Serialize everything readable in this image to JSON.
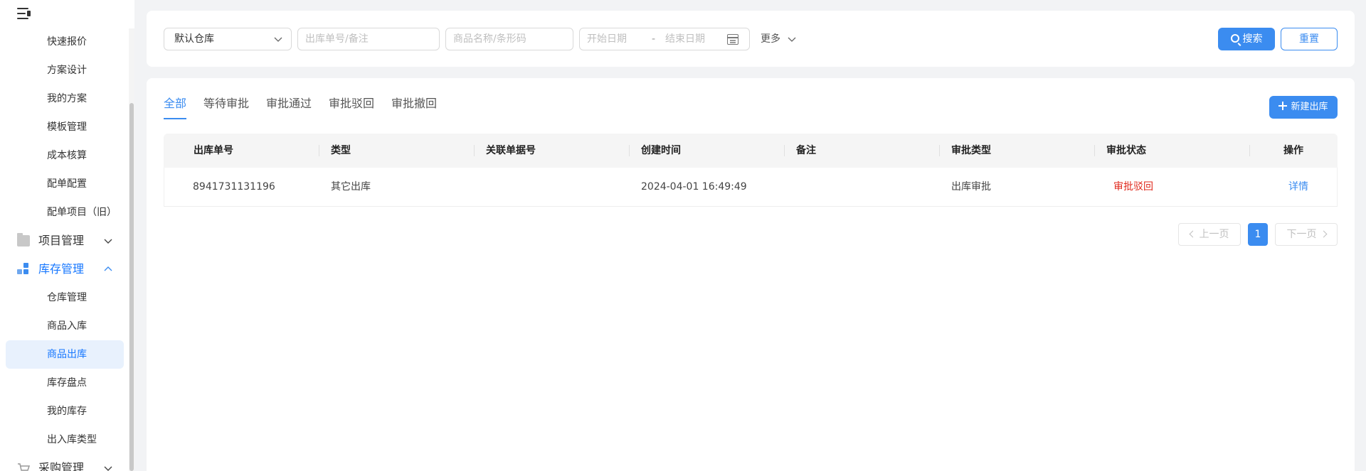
{
  "sidebar": {
    "sub_items_top": [
      {
        "label": "快速报价"
      },
      {
        "label": "方案设计"
      },
      {
        "label": "我的方案"
      },
      {
        "label": "模板管理"
      },
      {
        "label": "成本核算"
      },
      {
        "label": "配单配置"
      },
      {
        "label": "配单项目（旧）"
      }
    ],
    "group_project": {
      "label": "项目管理",
      "icon": "folder-icon"
    },
    "group_inventory": {
      "label": "库存管理",
      "icon": "inventory-icon"
    },
    "inventory_items": [
      {
        "label": "仓库管理"
      },
      {
        "label": "商品入库"
      },
      {
        "label": "商品出库",
        "active": true
      },
      {
        "label": "库存盘点"
      },
      {
        "label": "我的库存"
      },
      {
        "label": "出入库类型"
      }
    ],
    "group_purchase": {
      "label": "采购管理",
      "icon": "cart-icon"
    }
  },
  "filters": {
    "warehouse_select": {
      "value": "默认仓库"
    },
    "order_input": {
      "placeholder": "出库单号/备注",
      "value": ""
    },
    "product_input": {
      "placeholder": "商品名称/条形码",
      "value": ""
    },
    "date_range": {
      "start_placeholder": "开始日期",
      "separator": "-",
      "end_placeholder": "结束日期"
    },
    "more_label": "更多",
    "search_label": "搜索",
    "reset_label": "重置"
  },
  "tabs": [
    {
      "label": "全部",
      "active": true
    },
    {
      "label": "等待审批"
    },
    {
      "label": "审批通过"
    },
    {
      "label": "审批驳回"
    },
    {
      "label": "审批撤回"
    }
  ],
  "new_button_label": "新建出库",
  "table": {
    "columns": [
      "出库单号",
      "类型",
      "关联单据号",
      "创建时间",
      "备注",
      "审批类型",
      "审批状态",
      "操作"
    ],
    "rows": [
      {
        "order_no": "8941731131196",
        "type": "其它出库",
        "related_no": "",
        "created_at": "2024-04-01 16:49:49",
        "remark": "",
        "approval_type": "出库审批",
        "approval_status": "审批驳回",
        "action": "详情"
      }
    ]
  },
  "pagination": {
    "prev_label": "上一页",
    "current_page": "1",
    "next_label": "下一页"
  },
  "colors": {
    "primary": "#3b8cf0",
    "status_rejected": "#e0281c",
    "page_bg": "#f2f3f5"
  }
}
